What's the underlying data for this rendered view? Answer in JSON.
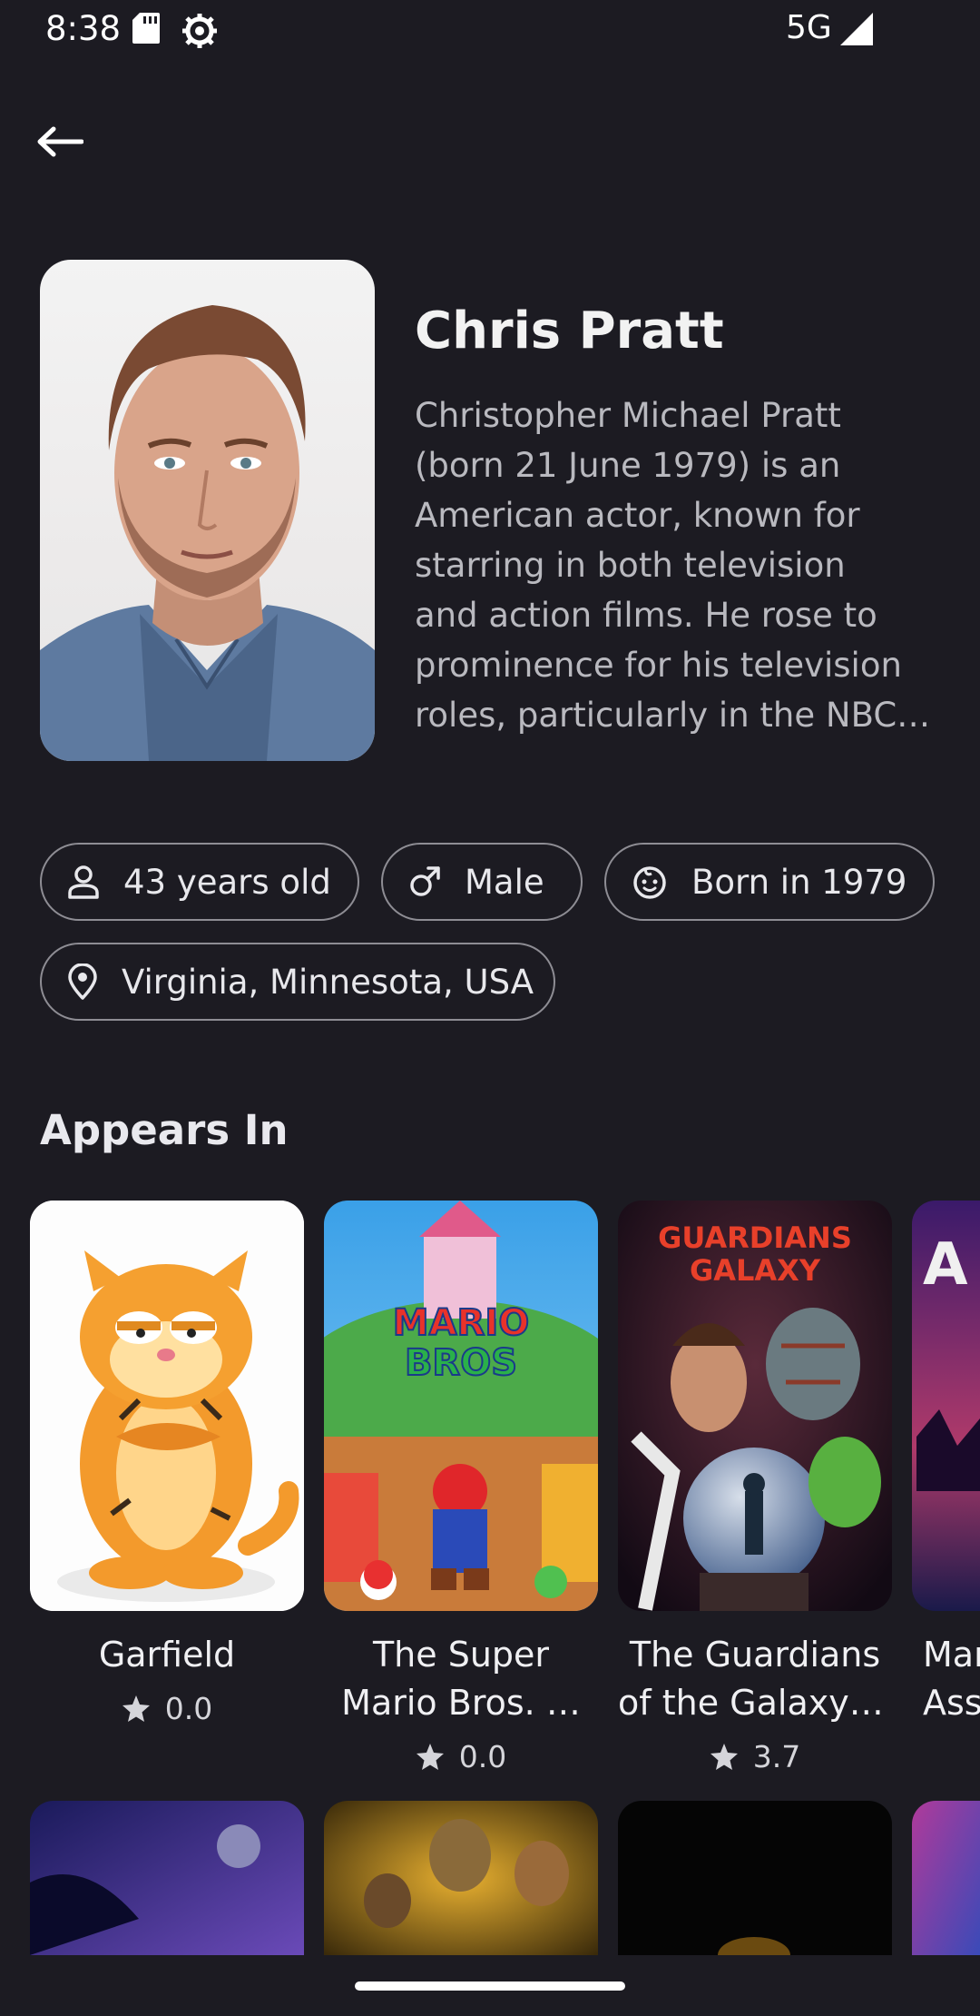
{
  "status_bar": {
    "time": "8:38",
    "network": "5G"
  },
  "actor": {
    "name": "Chris Pratt",
    "bio_lines": [
      "Christopher Michael Pratt",
      "(born 21 June 1979) is an",
      "American actor, known for",
      "starring in both television",
      "and action films. He rose to",
      "prominence for his television",
      "roles, particularly in the NBC…"
    ]
  },
  "chips": {
    "age": "43 years old",
    "gender": "Male",
    "born": "Born in 1979",
    "place": "Virginia, Minnesota, USA"
  },
  "appears_in": {
    "title": "Appears In",
    "movies": [
      {
        "title_lines": [
          "Garfield"
        ],
        "rating": "0.0"
      },
      {
        "title_lines": [
          "The Super",
          "Mario Bros. …"
        ],
        "rating": "0.0"
      },
      {
        "title_lines": [
          "The Guardians",
          "of the Galaxy …"
        ],
        "rating": "3.7"
      },
      {
        "title_lines": [
          "Mar",
          "Ass"
        ],
        "rating": ""
      }
    ]
  },
  "icons": {
    "back": "arrow-left-icon",
    "person": "person-icon",
    "male": "male-icon",
    "baby": "baby-face-icon",
    "location": "location-pin-icon",
    "star": "star-icon"
  },
  "colors": {
    "background": "#1c1b22",
    "chip_border": "#8e8d94",
    "bio_text": "#b9b9bf"
  }
}
